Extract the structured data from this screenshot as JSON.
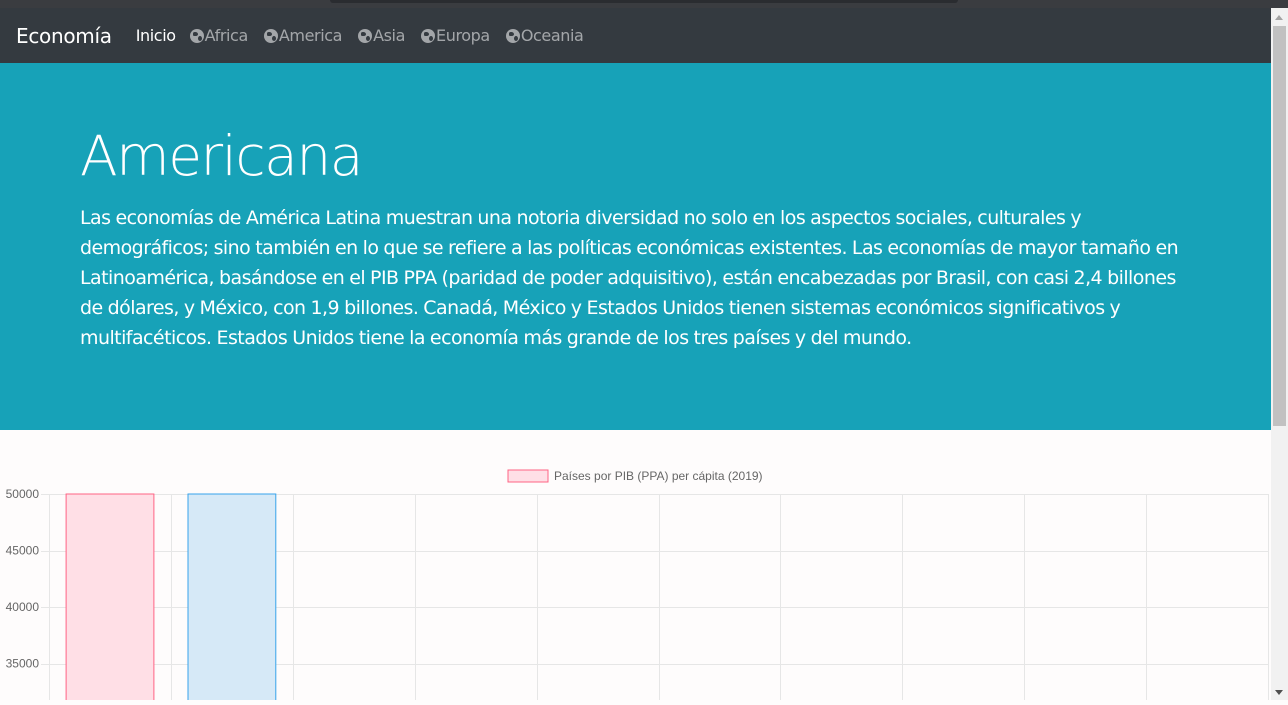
{
  "navbar": {
    "brand": "Economía",
    "items": [
      {
        "label": "Inicio",
        "icon": null,
        "active": true
      },
      {
        "label": "Africa",
        "icon": "globe-africa-icon",
        "active": false
      },
      {
        "label": "America",
        "icon": "globe-americas-icon",
        "active": false
      },
      {
        "label": "Asia",
        "icon": "globe-asia-icon",
        "active": false
      },
      {
        "label": "Europa",
        "icon": "globe-europe-icon",
        "active": false
      },
      {
        "label": "Oceania",
        "icon": "globe-oceania-icon",
        "active": false
      }
    ]
  },
  "jumbotron": {
    "title": "Americana",
    "text": "Las economías de América Latina muestran una notoria diversidad no solo en los aspectos sociales, culturales y demográficos; sino también en lo que se refiere a las políticas económicas existentes. Las economías de mayor tamaño en Latinoamérica, basándose en el PIB PPA (paridad de poder adquisitivo), están encabezadas por Brasil, con casi 2,4 billones de dólares, y México, con 1,9 billones. Canadá, México y Estados Unidos tienen sistemas económicos significativos y multifacéticos. Estados Unidos tiene la economía más grande de los tres países y del mundo.",
    "background": "#17a2b8"
  },
  "chart_data": {
    "type": "bar",
    "legend": "Países por PIB (PPA) per cápita (2019)",
    "legend_position": "top",
    "grid": true,
    "categories": [
      "",
      "",
      "",
      "",
      "",
      "",
      "",
      "",
      "",
      ""
    ],
    "values": [
      50000,
      50000,
      null,
      null,
      null,
      null,
      null,
      null,
      null,
      null
    ],
    "bar_fills": [
      "#ffdfe6",
      "#d6e9f7"
    ],
    "bar_strokes": [
      "#ff6384",
      "#36a2eb"
    ],
    "yticks": [
      "50000",
      "45000",
      "40000",
      "35000"
    ],
    "ylim_visible": [
      32000,
      50000
    ]
  }
}
